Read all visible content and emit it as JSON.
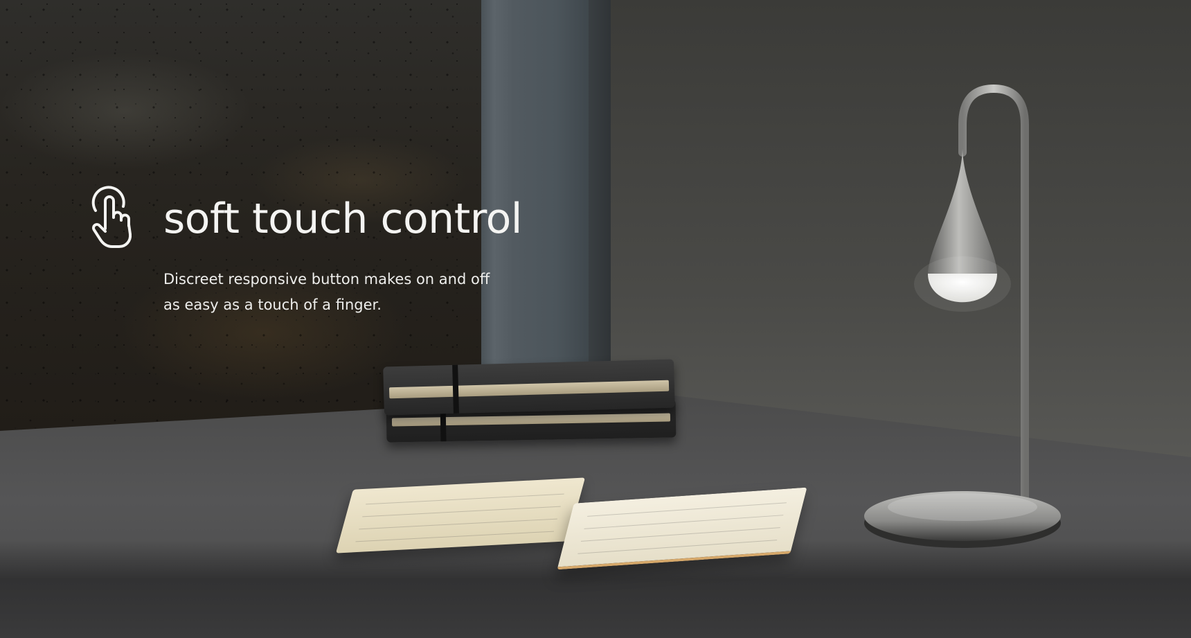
{
  "feature": {
    "icon": "touch-finger-icon",
    "title": "soft touch control",
    "description_lines": [
      "Discreet responsive button makes on and off",
      "as easy as a touch of a finger."
    ]
  },
  "colors": {
    "text": "#f4f4f2",
    "background": "#2a2a2a"
  }
}
